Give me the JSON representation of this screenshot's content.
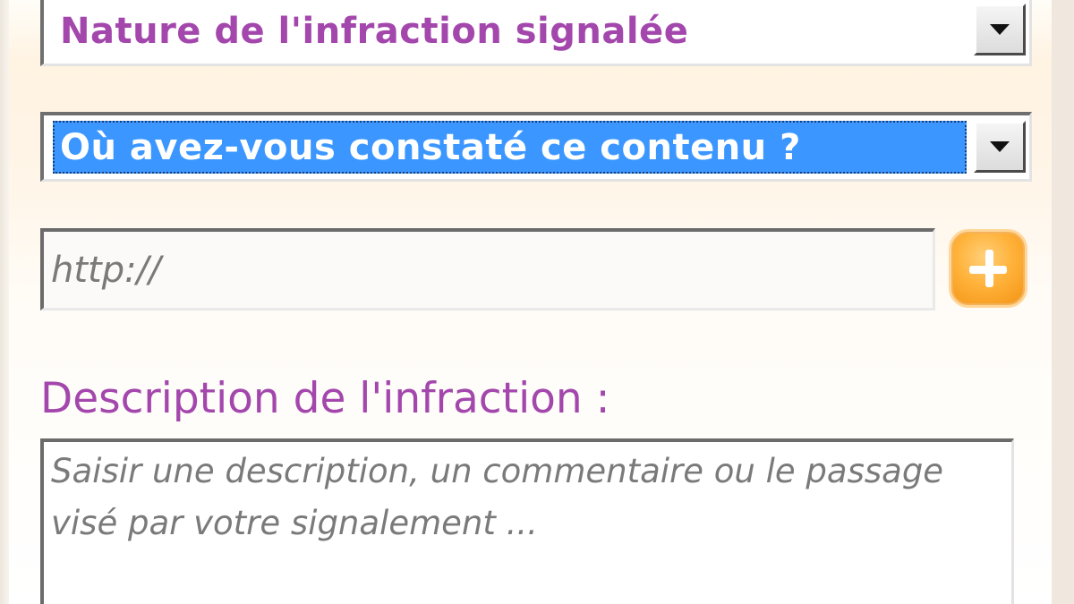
{
  "form": {
    "nature_select": {
      "value": "Nature de l'infraction signalée"
    },
    "location_select": {
      "value": "Où avez-vous constaté ce contenu ?"
    },
    "url_field": {
      "placeholder": "http://"
    },
    "add_button": {
      "icon": "plus-icon"
    },
    "description": {
      "label": "Description de l'infraction :",
      "placeholder": "Saisir une description, un commentaire ou le passage visé par votre signalement ..."
    }
  },
  "colors": {
    "label_text": "#a347ad",
    "selected_highlight": "#3b97ff",
    "add_button": "#ffb23a"
  }
}
